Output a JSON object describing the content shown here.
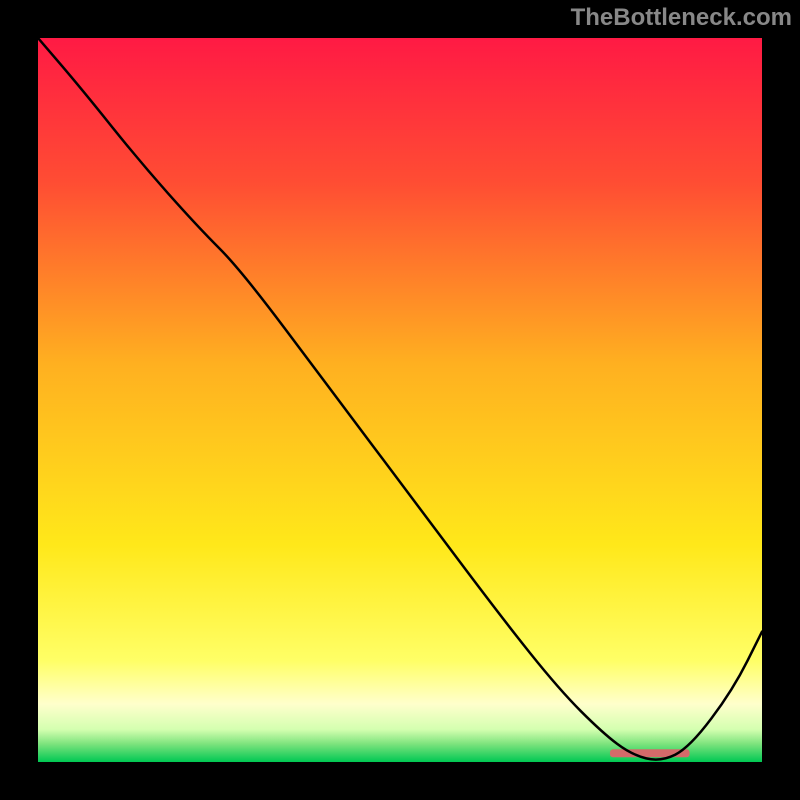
{
  "attribution": "TheBottleneck.com",
  "chart_data": {
    "type": "line",
    "title": "",
    "xlabel": "",
    "ylabel": "",
    "xlim": [
      0,
      100
    ],
    "ylim": [
      0,
      100
    ],
    "background_gradient": {
      "stops": [
        {
          "pos": 0.0,
          "color": "#ff1a44"
        },
        {
          "pos": 0.2,
          "color": "#ff4d33"
        },
        {
          "pos": 0.45,
          "color": "#ffb020"
        },
        {
          "pos": 0.7,
          "color": "#ffe81a"
        },
        {
          "pos": 0.86,
          "color": "#ffff66"
        },
        {
          "pos": 0.92,
          "color": "#ffffcc"
        },
        {
          "pos": 0.955,
          "color": "#d4ffb0"
        },
        {
          "pos": 0.975,
          "color": "#7de37d"
        },
        {
          "pos": 1.0,
          "color": "#00c853"
        }
      ]
    },
    "curve": {
      "x": [
        0,
        6,
        14,
        22,
        28,
        40,
        52,
        64,
        72,
        78,
        82,
        86,
        90,
        96,
        100
      ],
      "y": [
        100,
        93,
        83,
        74,
        68,
        52,
        36,
        20,
        10,
        4,
        1,
        0,
        2,
        10,
        18
      ]
    },
    "marker_bar": {
      "x_start": 79,
      "x_end": 90,
      "y": 1.2,
      "color": "#d46a6a",
      "radius": 3
    }
  }
}
